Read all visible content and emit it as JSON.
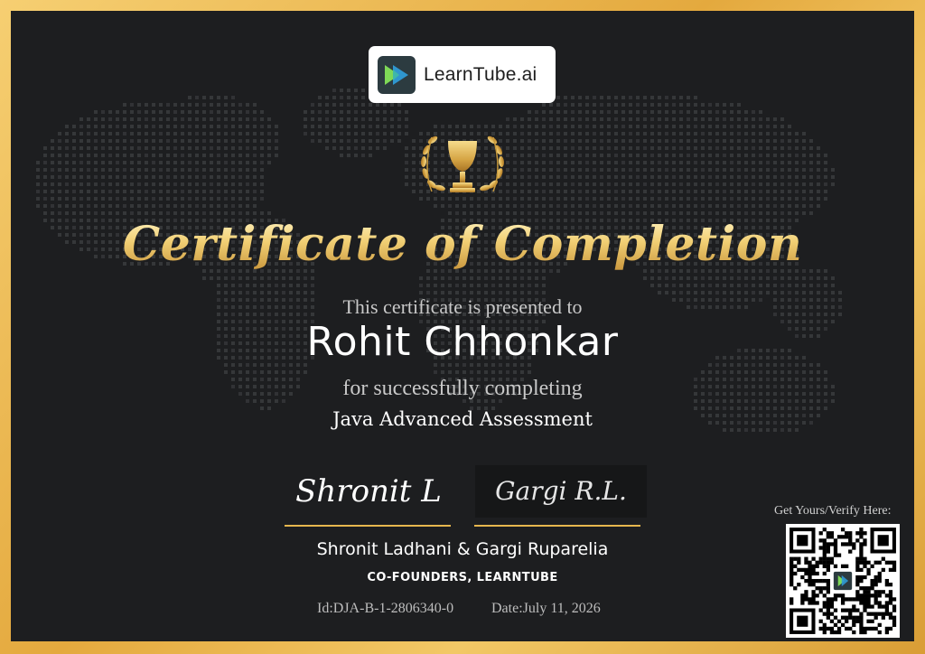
{
  "brand": {
    "name": "LearnTube.ai",
    "icon": "play-arrow-logo-icon"
  },
  "emblem": {
    "icon": "trophy-laurel-icon"
  },
  "certificate": {
    "title": "Certificate of Completion",
    "presented_text": "This certificate is presented to",
    "recipient": "Rohit Chhonkar",
    "completion_text": "for successfully completing",
    "course": "Java Advanced Assessment"
  },
  "signatures": {
    "left": "Shronit L",
    "right": "Gargi R.L."
  },
  "founders": {
    "names": "Shronit Ladhani & Gargi Ruparelia",
    "role": "CO-FOUNDERS, LEARNTUBE"
  },
  "meta": {
    "id": "Id:DJA-B-1-2806340-0",
    "date": "Date:July 11, 2026"
  },
  "verify": {
    "label": "Get Yours/Verify Here:",
    "qr_icon": "qr-code-icon"
  },
  "colors": {
    "border_gold": "#e9b84f",
    "background": "#1d1e20",
    "accent_gold": "#e6b64e",
    "logo_green": "#7ed957",
    "logo_blue": "#2f9bd6"
  }
}
